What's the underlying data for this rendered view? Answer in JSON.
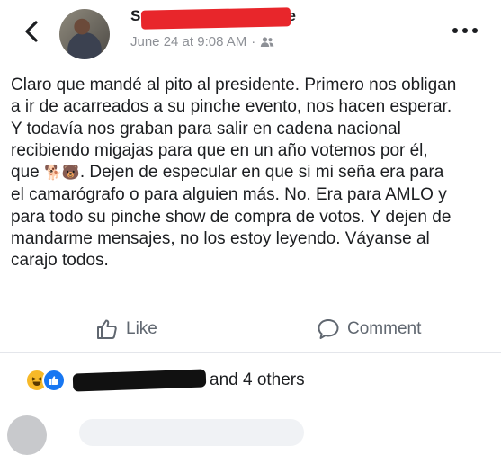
{
  "post": {
    "author_name_visible_start": "S",
    "author_name_visible_end": "e",
    "timestamp": "June 24 at 9:08 AM",
    "separator": "·",
    "privacy_icon": "friends-icon",
    "lines": [
      "Claro que mandé al pito al presidente. Primero nos obligan",
      "a ir de acarreados a su pinche evento, nos hacen esperar.",
      "Y todavía nos graban para salir en cadena nacional",
      "recibiendo migajas para que en un año votemos por él,",
      "que",
      "🐕🐻",
      ". Dejen de especular en que si mi seña era para",
      "el camarógrafo o para alguien más. No. Era para AMLO y",
      "para todo su pinche show de compra de votos. Y dejen de",
      "mandarme mensajes, no los estoy leyendo. Váyanse al",
      "carajo todos."
    ]
  },
  "actions": {
    "like_label": "Like",
    "comment_label": "Comment"
  },
  "reactions": {
    "others_text": "and 4 others"
  },
  "icons": {
    "back": "back-chevron-icon",
    "more": "more-options-icon",
    "like": "thumbs-up-icon",
    "comment": "comment-bubble-icon",
    "haha": "haha-reaction-icon",
    "like_reaction": "like-reaction-icon"
  }
}
